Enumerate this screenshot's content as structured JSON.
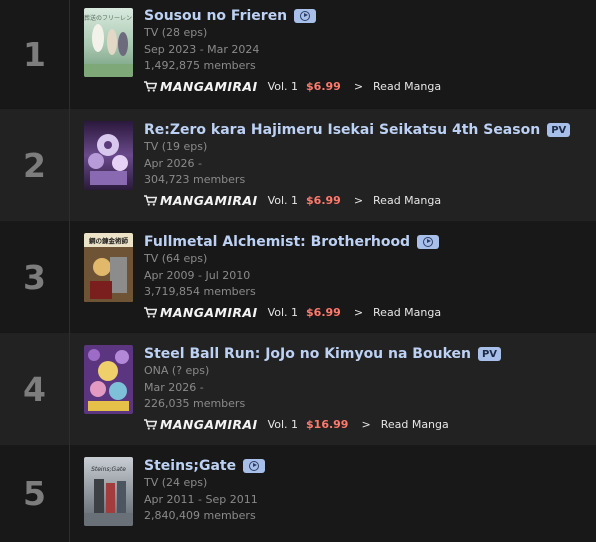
{
  "entries": [
    {
      "rank": "1",
      "title": "Sousou no Frieren",
      "badge": "play",
      "type": "TV (28 eps)",
      "dates": "Sep 2023 - Mar 2024",
      "members": "1,492,875 members",
      "manga": {
        "logo": "MANGAMIRAI",
        "vol": "Vol. 1",
        "price": "$6.99",
        "arrow": ">",
        "read": "Read Manga"
      },
      "cover_colors": [
        "#cfe3d6",
        "#8fb69a",
        "#e9ece2"
      ]
    },
    {
      "rank": "2",
      "title": "Re:Zero kara Hajimeru Isekai Seikatsu 4th Season",
      "badge": "pv",
      "badge_label": "PV",
      "type": "TV (19 eps)",
      "dates": "Apr 2026 -",
      "members": "304,723 members",
      "manga": {
        "logo": "MANGAMIRAI",
        "vol": "Vol. 1",
        "price": "$6.99",
        "arrow": ">",
        "read": "Read Manga"
      },
      "cover_colors": [
        "#3a1f4d",
        "#b58cd8",
        "#e8dcf2"
      ]
    },
    {
      "rank": "3",
      "title": "Fullmetal Alchemist: Brotherhood",
      "badge": "play",
      "type": "TV (64 eps)",
      "dates": "Apr 2009 - Jul 2010",
      "members": "3,719,854 members",
      "manga": {
        "logo": "MANGAMIRAI",
        "vol": "Vol. 1",
        "price": "$6.99",
        "arrow": ">",
        "read": "Read Manga"
      },
      "cover_colors": [
        "#f2ead6",
        "#8a6a3c",
        "#3b2a1c"
      ],
      "cover_text": "鋼の錬金術師"
    },
    {
      "rank": "4",
      "title": "Steel Ball Run: JoJo no Kimyou na Bouken",
      "badge": "pv",
      "badge_label": "PV",
      "type": "ONA (? eps)",
      "dates": "Mar 2026 -",
      "members": "226,035 members",
      "manga": {
        "logo": "MANGAMIRAI",
        "vol": "Vol. 1",
        "price": "$16.99",
        "arrow": ">",
        "read": "Read Manga"
      },
      "cover_colors": [
        "#6a3d8f",
        "#e6c14a",
        "#d98bb5"
      ]
    },
    {
      "rank": "5",
      "title": "Steins;Gate",
      "badge": "play",
      "type": "TV (24 eps)",
      "dates": "Apr 2011 - Sep 2011",
      "members": "2,840,409 members",
      "cover_colors": [
        "#9aa3ab",
        "#5a6068",
        "#c6ccd2"
      ],
      "cover_text": "Steins;Gate"
    }
  ],
  "colors": {
    "title": "#bcd1f3",
    "badge_bg": "#a8bfe9",
    "price": "#ff7a6b",
    "rank": "#7d7d7d",
    "meta": "#8a8a8a"
  }
}
